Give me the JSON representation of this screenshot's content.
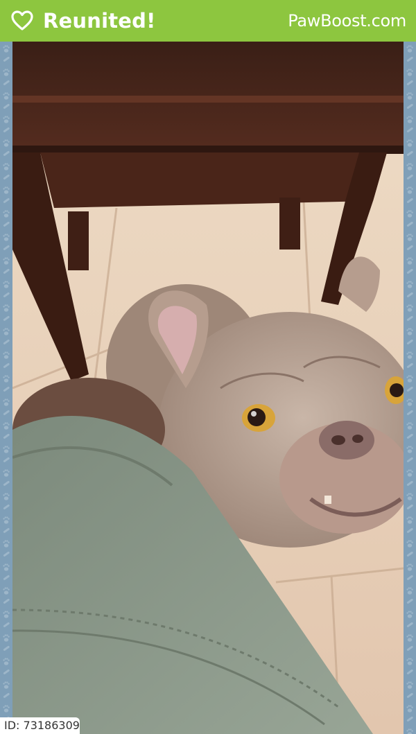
{
  "header": {
    "title": "Reunited!",
    "brand": "PawBoost.com",
    "background_color": "#8dc63f",
    "icon": "heart-outline-icon"
  },
  "border": {
    "color": "#7f9fb8",
    "icon": "paw-print-icon"
  },
  "photo": {
    "subject": "dog"
  },
  "footer": {
    "id_text": "ID: 73186309"
  }
}
